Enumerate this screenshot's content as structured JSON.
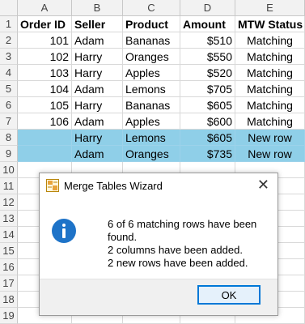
{
  "columns": [
    "A",
    "B",
    "C",
    "D",
    "E"
  ],
  "row_numbers": [
    "1",
    "2",
    "3",
    "4",
    "5",
    "6",
    "7",
    "8",
    "9",
    "10",
    "11",
    "12",
    "13",
    "14",
    "15",
    "16",
    "17",
    "18",
    "19"
  ],
  "header": [
    "Order ID",
    "Seller",
    "Product",
    "Amount",
    "MTW Status"
  ],
  "rows": [
    [
      "101",
      "Adam",
      "Bananas",
      "$510",
      "Matching"
    ],
    [
      "102",
      "Harry",
      "Oranges",
      "$550",
      "Matching"
    ],
    [
      "103",
      "Harry",
      "Apples",
      "$520",
      "Matching"
    ],
    [
      "104",
      "Adam",
      "Lemons",
      "$705",
      "Matching"
    ],
    [
      "105",
      "Harry",
      "Bananas",
      "$605",
      "Matching"
    ],
    [
      "106",
      "Adam",
      "Apples",
      "$600",
      "Matching"
    ],
    [
      "",
      "Harry",
      "Lemons",
      "$605",
      "New row"
    ],
    [
      "",
      "Adam",
      "Oranges",
      "$735",
      "New row"
    ]
  ],
  "highlight_color": "#8fcfe8",
  "dialog": {
    "title": "Merge Tables Wizard",
    "close_label": "✕",
    "icon": "info-icon",
    "messages": [
      "6 of 6 matching rows have been found.",
      "2 columns have been added.",
      "2 new rows have been added."
    ],
    "ok_label": "OK"
  }
}
